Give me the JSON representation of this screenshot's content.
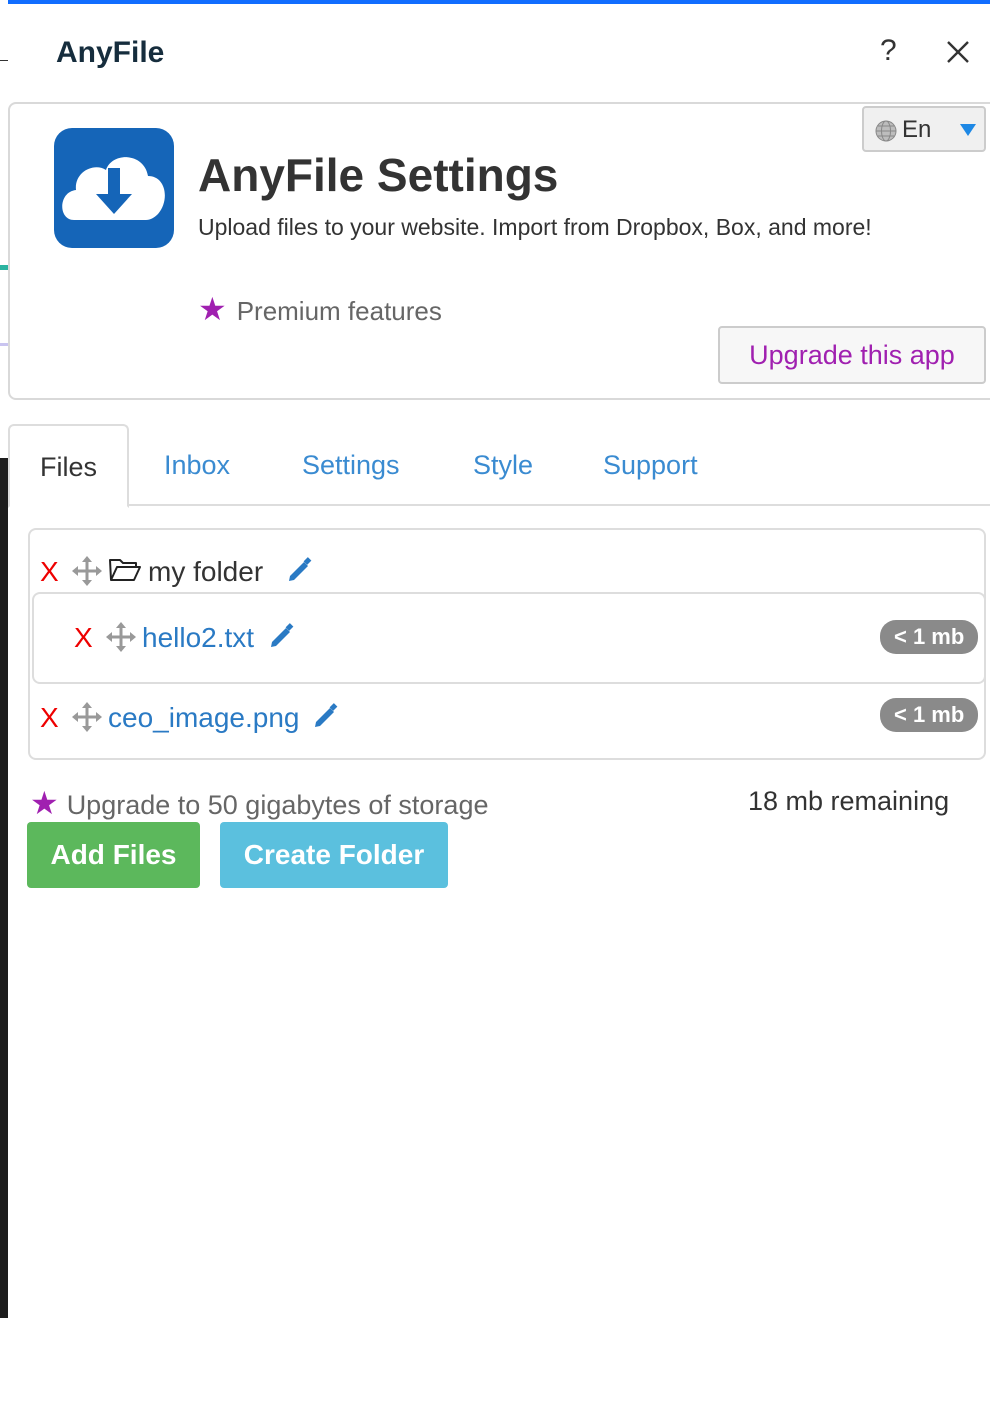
{
  "window": {
    "title": "AnyFile",
    "help_label": "?"
  },
  "app": {
    "title": "AnyFile Settings",
    "description": "Upload files to your website. Import from Dropbox, Box, and more!",
    "premium_label": "Premium features",
    "upgrade_button": "Upgrade this app",
    "language": "En",
    "colors": {
      "brand": "#1565b8",
      "premium": "#a020b0",
      "accent": "#116dff"
    }
  },
  "tabs": [
    {
      "label": "Files",
      "active": true
    },
    {
      "label": "Inbox"
    },
    {
      "label": "Settings"
    },
    {
      "label": "Style"
    },
    {
      "label": "Support"
    }
  ],
  "files": {
    "folder": {
      "name": "my folder",
      "delete_label": "X"
    },
    "items": [
      {
        "name": "hello2.txt",
        "size": "< 1 mb",
        "delete_label": "X",
        "in_folder": true
      },
      {
        "name": "ceo_image.png",
        "size": "< 1 mb",
        "delete_label": "X",
        "in_folder": false
      }
    ]
  },
  "storage": {
    "upgrade_label": "Upgrade to 50 gigabytes of storage",
    "remaining": "18 mb remaining"
  },
  "actions": {
    "add_files": "Add Files",
    "create_folder": "Create Folder"
  }
}
